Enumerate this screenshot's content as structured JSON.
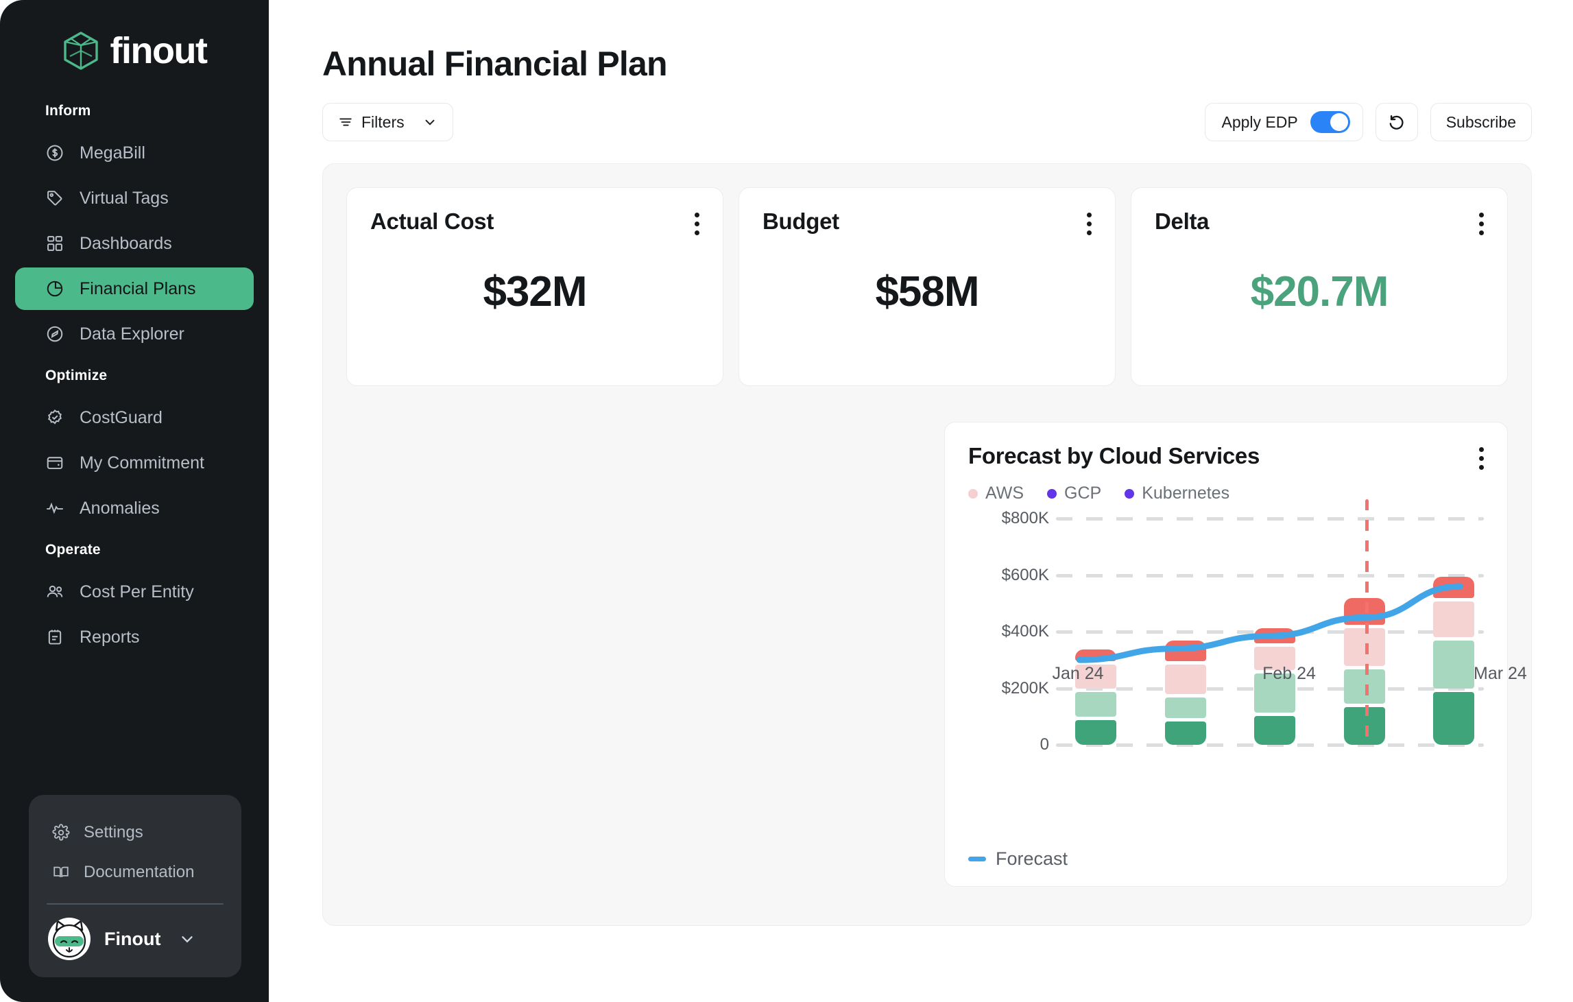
{
  "brand": {
    "name": "finout",
    "logo_icon": "finout-cube-logo"
  },
  "sidebar": {
    "sections": [
      {
        "label": "Inform",
        "items": [
          {
            "label": "MegaBill",
            "icon": "dollar-circle-icon",
            "active": false
          },
          {
            "label": "Virtual Tags",
            "icon": "tag-icon",
            "active": false
          },
          {
            "label": "Dashboards",
            "icon": "grid-icon",
            "active": false
          },
          {
            "label": "Financial Plans",
            "icon": "pie-chart-icon",
            "active": true
          },
          {
            "label": "Data Explorer",
            "icon": "compass-icon",
            "active": false
          }
        ]
      },
      {
        "label": "Optimize",
        "items": [
          {
            "label": "CostGuard",
            "icon": "badge-check-icon",
            "active": false
          },
          {
            "label": "My Commitment",
            "icon": "wallet-icon",
            "active": false
          },
          {
            "label": "Anomalies",
            "icon": "pulse-icon",
            "active": false
          }
        ]
      },
      {
        "label": "Operate",
        "items": [
          {
            "label": "Cost Per Entity",
            "icon": "users-icon",
            "active": false
          },
          {
            "label": "Reports",
            "icon": "clipboard-icon",
            "active": false
          }
        ]
      }
    ],
    "bottom": {
      "items": [
        {
          "label": "Settings",
          "icon": "gear-icon"
        },
        {
          "label": "Documentation",
          "icon": "book-icon"
        }
      ],
      "user": {
        "name": "Finout",
        "avatar_icon": "cat-avatar-icon",
        "caret_icon": "chevron-down-icon"
      }
    }
  },
  "header": {
    "title": "Annual Financial Plan",
    "filters_label": "Filters",
    "filters_icon": "filter-icon",
    "filters_caret_icon": "chevron-down-icon",
    "apply_edp_label": "Apply EDP",
    "apply_edp_on": true,
    "reset_icon": "undo-rotate-icon",
    "subscribe_label": "Subscribe"
  },
  "kpis": [
    {
      "title": "Actual Cost",
      "value": "$32M",
      "accent": "#15181b",
      "menu_icon": "kebab-menu-icon"
    },
    {
      "title": "Budget",
      "value": "$58M",
      "accent": "#15181b",
      "menu_icon": "kebab-menu-icon"
    },
    {
      "title": "Delta",
      "value": "$20.7M",
      "accent": "#4aa37c",
      "menu_icon": "kebab-menu-icon"
    }
  ],
  "chart_card": {
    "title": "Forecast by Cloud Services",
    "menu_icon": "kebab-menu-icon",
    "legend": [
      {
        "label": "AWS",
        "color": "#f6d0d0"
      },
      {
        "label": "GCP",
        "color": "#6335e8"
      },
      {
        "label": "Kubernetes",
        "color": "#6335e8"
      }
    ],
    "footer_legend": {
      "label": "Forecast",
      "color": "#41a5e8"
    }
  },
  "chart_data": {
    "type": "bar",
    "stacked": true,
    "title": "Forecast by Cloud Services",
    "xlabel": "",
    "ylabel": "",
    "ylim": [
      0,
      800000
    ],
    "grid": true,
    "legend_position": "top-left",
    "categories": [
      "Jan 24",
      "",
      "Feb 24",
      "",
      "Mar 24"
    ],
    "tick_labels": [
      "0",
      "$200K",
      "$400K",
      "$600K",
      "$800K"
    ],
    "tick_values": [
      0,
      200000,
      400000,
      600000,
      800000
    ],
    "series": [
      {
        "name": "Kubernetes",
        "color": "#3fa47a",
        "values": [
          100000,
          95000,
          115000,
          145000,
          200000
        ]
      },
      {
        "name": "GCP",
        "color": "#a7d8bf",
        "values": [
          100000,
          85000,
          150000,
          135000,
          180000
        ]
      },
      {
        "name": "AWS",
        "color": "#f5d3d3",
        "values": [
          95000,
          115000,
          95000,
          145000,
          140000
        ]
      },
      {
        "name": "Forecasted",
        "color": "#ef6a63",
        "values": [
          55000,
          85000,
          65000,
          105000,
          85000
        ]
      }
    ],
    "line_series": {
      "name": "Forecast",
      "color": "#41a5e8",
      "values": [
        300000,
        340000,
        385000,
        450000,
        560000
      ]
    },
    "marker_line": {
      "x_index": 3,
      "color": "#f2726e",
      "style": "dashed",
      "label": ""
    }
  }
}
